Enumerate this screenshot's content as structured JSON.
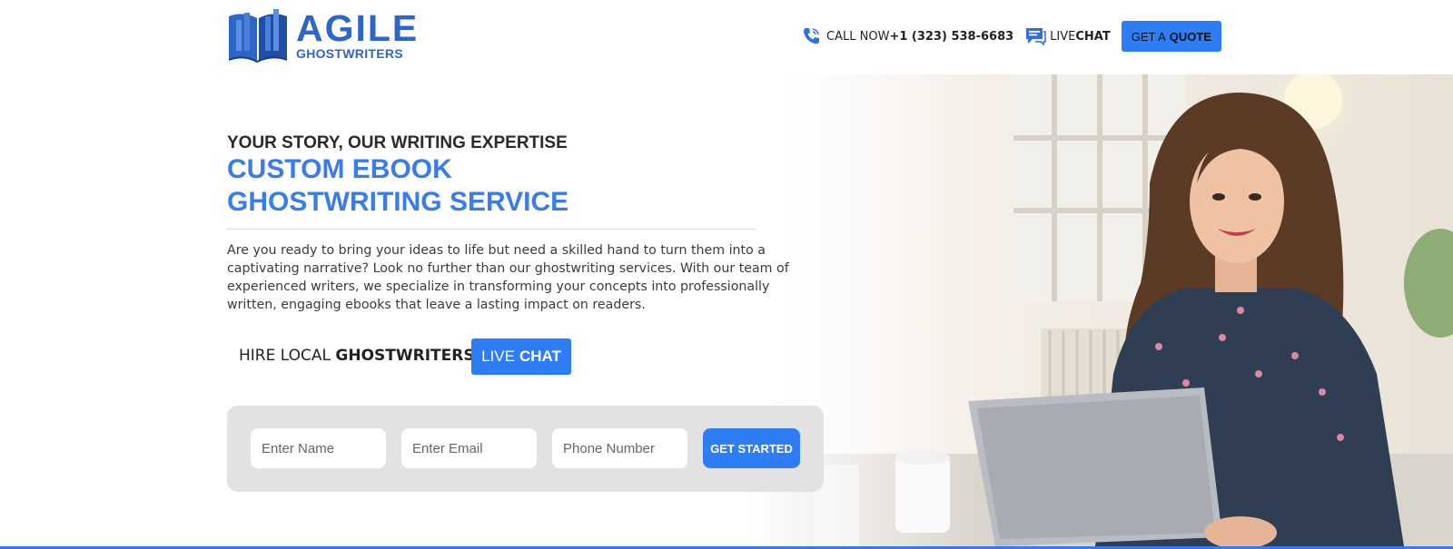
{
  "header": {
    "logo": {
      "main": "AGILE",
      "sub": "GHOSTWRITERS"
    },
    "call_prefix": "CALL NOW",
    "call_number": "+1 (323) 538-6683",
    "live_prefix": "LIVE",
    "live_bold": "CHAT",
    "quote_prefix": "GET A",
    "quote_bold": "QUOTE"
  },
  "hero": {
    "tagline": "YOUR STORY, OUR WRITING EXPERTISE",
    "headline_line1": "CUSTOM EBOOK",
    "headline_line2": "GHOSTWRITING SERVICE",
    "description": "Are you ready to bring your ideas to life but need a skilled hand to turn them into a captivating narrative? Look no further than our ghostwriting services. With our team of experienced writers, we specialize in transforming your concepts into professionally written, engaging ebooks that leave a lasting impact on readers.",
    "hire_prefix": "HIRE LOCAL",
    "hire_bold": "GHOSTWRITERS",
    "livechat_prefix": "LIVE",
    "livechat_bold": "CHAT"
  },
  "form": {
    "name_placeholder": "Enter Name",
    "email_placeholder": "Enter Email",
    "phone_placeholder": "Phone Number",
    "submit_label": "GET STARTED"
  },
  "colors": {
    "accent": "#2f7df4",
    "headline": "#3a7de6",
    "logo": "#2e65c8",
    "form_bg": "#e2e2e2"
  },
  "icons": {
    "call": "phone-icon",
    "chat": "chat-bubble-icon"
  }
}
